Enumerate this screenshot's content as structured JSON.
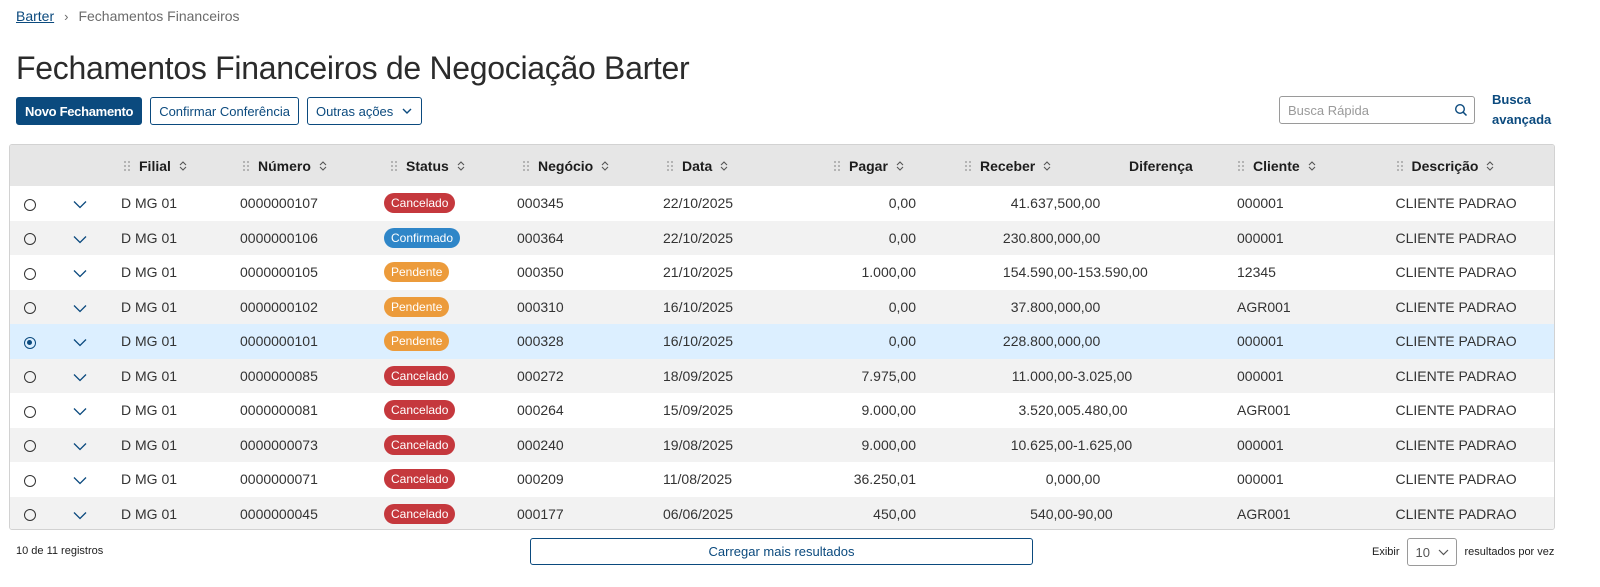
{
  "breadcrumb": {
    "root": "Barter",
    "current": "Fechamentos Financeiros"
  },
  "page_title": "Fechamentos Financeiros de Negociação Barter",
  "toolbar": {
    "new_label": "Novo Fechamento",
    "confirm_label": "Confirmar Conferência",
    "more_label": "Outras ações"
  },
  "search": {
    "placeholder": "Busca Rápida",
    "advanced_label": "Busca avançada"
  },
  "columns": [
    "Filial",
    "Número",
    "Status",
    "Negócio",
    "Data",
    "Pagar",
    "Receber",
    "Diferença",
    "Cliente",
    "Descrição"
  ],
  "status_colors": {
    "Cancelado": "#c5383d",
    "Confirmado": "#2f86c8",
    "Pendente": "#ec9b3b"
  },
  "rows": [
    {
      "filial": "D MG 01",
      "numero": "0000000107",
      "status": "Cancelado",
      "negocio": "000345",
      "data": "22/10/2025",
      "pagar": "0,00",
      "receber": "41.637,50",
      "diferenca": "0,00",
      "cliente": "000001",
      "descricao": "CLIENTE PADRAO",
      "selected": false
    },
    {
      "filial": "D MG 01",
      "numero": "0000000106",
      "status": "Confirmado",
      "negocio": "000364",
      "data": "22/10/2025",
      "pagar": "0,00",
      "receber": "230.800,00",
      "diferenca": "0,00",
      "cliente": "000001",
      "descricao": "CLIENTE PADRAO",
      "selected": false
    },
    {
      "filial": "D MG 01",
      "numero": "0000000105",
      "status": "Pendente",
      "negocio": "000350",
      "data": "21/10/2025",
      "pagar": "1.000,00",
      "receber": "154.590,00",
      "diferenca": "-153.590,00",
      "cliente": "12345",
      "descricao": "CLIENTE PADRAO",
      "selected": false
    },
    {
      "filial": "D MG 01",
      "numero": "0000000102",
      "status": "Pendente",
      "negocio": "000310",
      "data": "16/10/2025",
      "pagar": "0,00",
      "receber": "37.800,00",
      "diferenca": "0,00",
      "cliente": "AGR001",
      "descricao": "CLIENTE PADRAO",
      "selected": false
    },
    {
      "filial": "D MG 01",
      "numero": "0000000101",
      "status": "Pendente",
      "negocio": "000328",
      "data": "16/10/2025",
      "pagar": "0,00",
      "receber": "228.800,00",
      "diferenca": "0,00",
      "cliente": "000001",
      "descricao": "CLIENTE PADRAO",
      "selected": true
    },
    {
      "filial": "D MG 01",
      "numero": "0000000085",
      "status": "Cancelado",
      "negocio": "000272",
      "data": "18/09/2025",
      "pagar": "7.975,00",
      "receber": "11.000,00",
      "diferenca": "-3.025,00",
      "cliente": "000001",
      "descricao": "CLIENTE PADRAO",
      "selected": false
    },
    {
      "filial": "D MG 01",
      "numero": "0000000081",
      "status": "Cancelado",
      "negocio": "000264",
      "data": "15/09/2025",
      "pagar": "9.000,00",
      "receber": "3.520,00",
      "diferenca": "5.480,00",
      "cliente": "AGR001",
      "descricao": "CLIENTE PADRAO",
      "selected": false
    },
    {
      "filial": "D MG 01",
      "numero": "0000000073",
      "status": "Cancelado",
      "negocio": "000240",
      "data": "19/08/2025",
      "pagar": "9.000,00",
      "receber": "10.625,00",
      "diferenca": "-1.625,00",
      "cliente": "000001",
      "descricao": "CLIENTE PADRAO",
      "selected": false
    },
    {
      "filial": "D MG 01",
      "numero": "0000000071",
      "status": "Cancelado",
      "negocio": "000209",
      "data": "11/08/2025",
      "pagar": "36.250,01",
      "receber": "0,00",
      "diferenca": "0,00",
      "cliente": "000001",
      "descricao": "CLIENTE PADRAO",
      "selected": false
    },
    {
      "filial": "D MG 01",
      "numero": "0000000045",
      "status": "Cancelado",
      "negocio": "000177",
      "data": "06/06/2025",
      "pagar": "450,00",
      "receber": "540,00",
      "diferenca": "-90,00",
      "cliente": "AGR001",
      "descricao": "CLIENTE PADRAO",
      "selected": false
    }
  ],
  "footer": {
    "count_label": "10 de 11 registros",
    "load_more_label": "Carregar mais resultados",
    "show_label": "Exibir",
    "page_size": "10",
    "per_page_label": "resultados por vez"
  }
}
